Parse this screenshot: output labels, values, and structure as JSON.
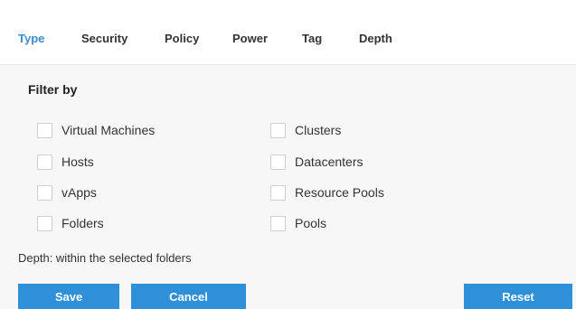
{
  "tabs": [
    {
      "label": "Type",
      "active": true
    },
    {
      "label": "Security",
      "active": false
    },
    {
      "label": "Policy",
      "active": false
    },
    {
      "label": "Power",
      "active": false
    },
    {
      "label": "Tag",
      "active": false
    },
    {
      "label": "Depth",
      "active": false
    }
  ],
  "filter": {
    "title": "Filter by",
    "left_options": [
      {
        "label": "Virtual Machines",
        "checked": false
      },
      {
        "label": "Hosts",
        "checked": false
      },
      {
        "label": "vApps",
        "checked": false
      },
      {
        "label": "Folders",
        "checked": false
      }
    ],
    "right_options": [
      {
        "label": "Clusters",
        "checked": false
      },
      {
        "label": "Datacenters",
        "checked": false
      },
      {
        "label": "Resource Pools",
        "checked": false
      },
      {
        "label": "Pools",
        "checked": false
      }
    ]
  },
  "depth_note": "Depth: within the selected folders",
  "buttons": {
    "save": "Save",
    "cancel": "Cancel",
    "reset": "Reset"
  },
  "colors": {
    "accent": "#2f8fd8",
    "active_tab": "#3d8bd2"
  }
}
